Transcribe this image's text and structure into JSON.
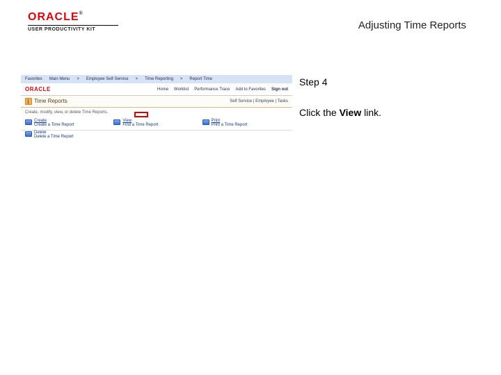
{
  "header": {
    "brand": "ORACLE",
    "product_line": "USER PRODUCTIVITY KIT",
    "title": "Adjusting Time Reports"
  },
  "instructions": {
    "step_label": "Step 4",
    "line_prefix": "Click the ",
    "bold_word": "View",
    "line_suffix": " link."
  },
  "app": {
    "greeting": {
      "favorites": "Favorites",
      "main_menu": "Main Menu",
      "crumb1": "Employee Self-Service",
      "crumb2": "Time Reporting",
      "crumb3": "Report Time"
    },
    "brand": "ORACLE",
    "nav": {
      "home": "Home",
      "worklist": "Worklist",
      "perf": "Performance Trace",
      "addfav": "Add to Favorites",
      "signout": "Sign out"
    },
    "page_title": "Time Reports",
    "help_trail": "Self Service | Employee | Tasks",
    "instruction": "Create, modify, view, or delete Time Reports.",
    "links": {
      "create": "Create",
      "create_sub": "Create a Time Report",
      "view": "View",
      "view_sub": "Find a Time Report",
      "print": "Print",
      "print_sub": "Print a Time Report",
      "delete": "Delete",
      "delete_sub": "Delete a Time Report"
    }
  }
}
